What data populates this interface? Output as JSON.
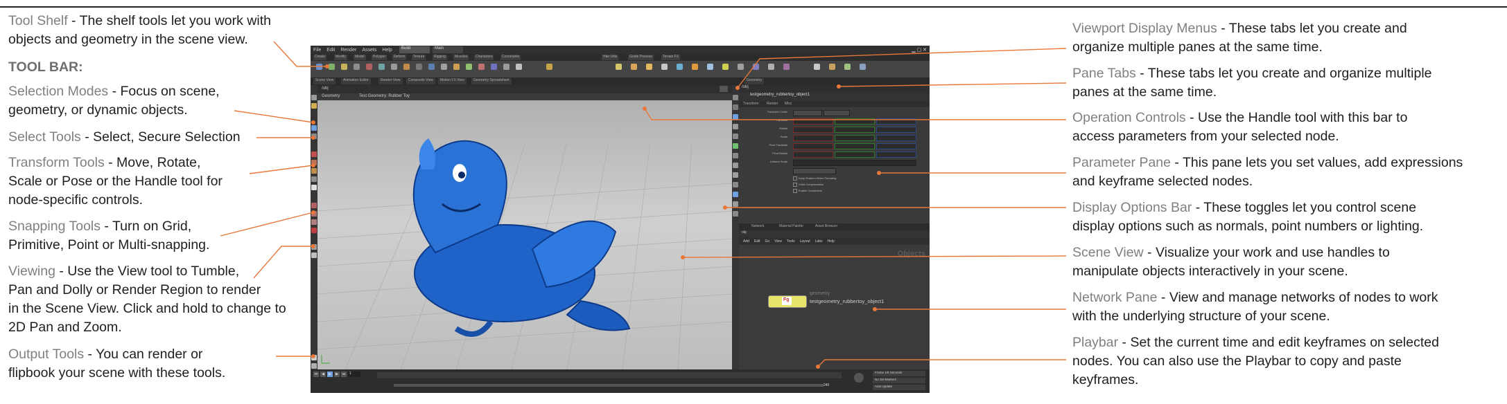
{
  "left_notes": [
    {
      "term": "Tool Shelf",
      "desc": " - The shelf tools let you work with",
      "line2": "objects and geometry in the scene view."
    },
    {
      "heading": "TOOL BAR:"
    },
    {
      "term": "Selection Modes",
      "desc": " - Focus on scene,",
      "line2": "geometry, or dynamic objects."
    },
    {
      "term": "Select Tools",
      "desc": " - Select, Secure Selection"
    },
    {
      "term": "Transform Tools",
      "desc": " - Move, Rotate,",
      "line2": "Scale or Pose or the Handle tool for",
      "line3": "node-specific controls."
    },
    {
      "term": "Snapping Tools",
      "desc": " - Turn on Grid,",
      "line2": "Primitive, Point or Multi-snapping."
    },
    {
      "term": "Viewing",
      "desc": " - Use the View tool to Tumble,",
      "line2": "Pan and Dolly or Render Region to render",
      "line3": "in the Scene View. Click and hold to change to",
      "line4": "2D Pan and Zoom."
    },
    {
      "term": "Output Tools",
      "desc": " - You can render or",
      "line2": "flipbook your scene with these tools."
    }
  ],
  "right_notes": [
    {
      "term": "Viewport Display Menus",
      "desc": " - These tabs let you create and",
      "line2": "organize multiple panes at the same time."
    },
    {
      "term": "Pane Tabs",
      "desc": " - These tabs let you create and organize multiple",
      "line2": "panes at the same time."
    },
    {
      "term": "Operation Controls",
      "desc": " - Use the Handle tool with this bar to",
      "line2": "access parameters from your selected node."
    },
    {
      "term": "Parameter Pane",
      "desc": " - This pane lets you set values, add expressions",
      "line2": "and keyframe selected nodes."
    },
    {
      "term": "Display Options Bar",
      "desc": " - These toggles let you control scene",
      "line2": "display options such as normals, point numbers or lighting."
    },
    {
      "term": "Scene View",
      "desc": " - Visualize your work and use handles to",
      "line2": "manipulate objects interactively in your scene."
    },
    {
      "term": "Network Pane",
      "desc": " - View and manage networks of nodes to work",
      "line2": "with the underlying structure of your scene."
    },
    {
      "term": "Playbar",
      "desc": " - Set the current time and edit keyframes on selected",
      "line2": "nodes. You can also use the Playbar to copy and paste",
      "line3": "keyframes."
    }
  ],
  "app": {
    "menus": [
      "File",
      "Edit",
      "Render",
      "Assets",
      "Help",
      "Build"
    ],
    "desktop_tab": "Build",
    "desktop_tab2": "Main",
    "shelf_tabs": [
      "Create",
      "Modify",
      "Model",
      "Polygon",
      "Deform",
      "Texture",
      "Rigging",
      "Muscles",
      "Characters",
      "Constraints",
      "Hair Utils",
      "Guide Process",
      "Terrain FX"
    ],
    "pane_tabs": [
      "Scene View",
      "Animation Editor",
      "Render View",
      "Composite View",
      "Motion FX View",
      "Geometry Spreadsheet"
    ],
    "viewport_header": "Geometry",
    "viewport_path": "/obj",
    "viewport_op": "Test Geometry: Rubber Toy",
    "viewport_shading": "Persp",
    "param_header": "Geometry",
    "param_node": "testgeometry_rubbertoy_object1",
    "param_tabs": [
      "Transform",
      "Render",
      "Misc"
    ],
    "param_rows": [
      "Transform Order",
      "Translate",
      "Rotate",
      "Scale",
      "Pivot Translate",
      "Pivot Rotate",
      "Uniform Scale"
    ],
    "param_checks": [
      "Keep Position When Parenting",
      "Child Compensation",
      "Enable Constraints"
    ],
    "net_tabs": [
      "Network",
      "Material Palette",
      "Asset Browser"
    ],
    "net_path": "obj",
    "net_menus": [
      "Add",
      "Edit",
      "Go",
      "View",
      "Tools",
      "Layout",
      "Labs",
      "Help"
    ],
    "net_title": "Objects",
    "node_type": "geometry",
    "node_name": "testgeometry_rubbertoy_object1",
    "node_flag": "Fg",
    "playbar_frame": "1",
    "playbar_end": "240",
    "playbar_opts": [
      "Frame 1/6 Seconds",
      "No Sel Markers",
      "Auto Update"
    ]
  },
  "colors": {
    "accent": "#e8783a",
    "toy_blue": "#1f63c8"
  }
}
